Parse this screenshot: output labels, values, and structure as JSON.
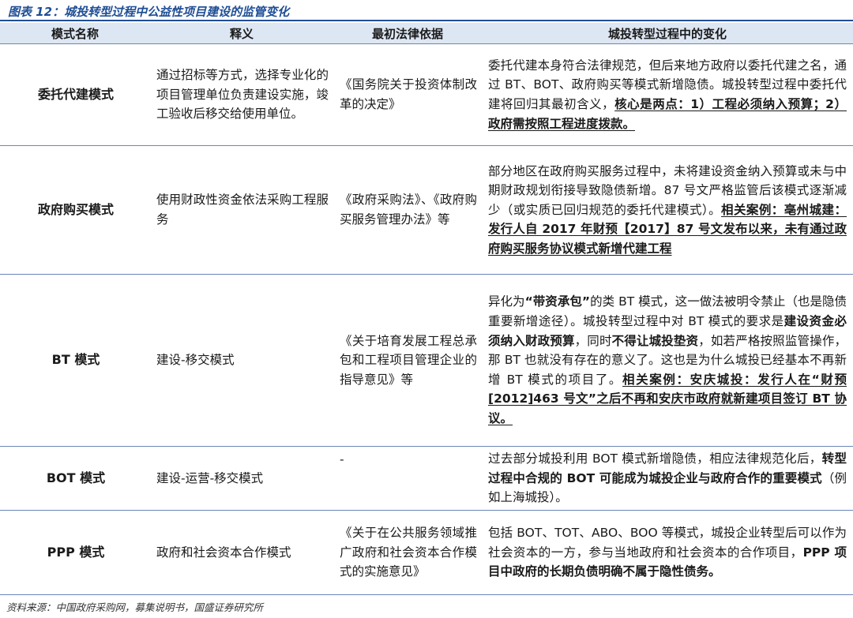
{
  "title": "图表 12：城投转型过程中公益性项目建设的监管变化",
  "headers": [
    "模式名称",
    "释义",
    "最初法律依据",
    "城投转型过程中的变化"
  ],
  "rows": [
    {
      "name": "委托代建模式",
      "desc": "通过招标等方式，选择专业化的项目管理单位负责建设实施，竣工验收后移交给使用单位。",
      "law": "《国务院关于投资体制改革的决定》",
      "change": [
        {
          "t": "委托代建本身符合法律规范，但后来地方政府以委托代建之名，通过 BT、BOT、政府购买等模式新增隐债。城投转型过程中委托代建将回归其最初含义，",
          "s": ""
        },
        {
          "t": "核心是两点：1）工程必须纳入预算；2）政府需按照工程进度拨款。",
          "s": "bu"
        }
      ]
    },
    {
      "name": "政府购买模式",
      "desc": "使用财政性资金依法采购工程服务",
      "law": "《政府采购法》、《政府购买服务管理办法》等",
      "change": [
        {
          "t": "部分地区在政府购买服务过程中，未将建设资金纳入预算或未与中期财政规划衔接导致隐债新增。87 号文严格监管后该模式逐渐减少（或实质已回归规范的委托代建模式）。",
          "s": ""
        },
        {
          "t": "相关案例：亳州城建：发行人自 2017 年财预【2017】87 号文发布以来，未有通过政府购买服务协议模式新增代建工程",
          "s": "bu"
        }
      ]
    },
    {
      "name": "BT 模式",
      "desc": "建设-移交模式",
      "law": "《关于培育发展工程总承包和工程项目管理企业的指导意见》等",
      "change": [
        {
          "t": "异化为",
          "s": ""
        },
        {
          "t": "“带资承包”",
          "s": "b"
        },
        {
          "t": "的类 BT 模式，这一做法被明令禁止（也是隐债重要新增途径）。城投转型过程中对 BT 模式的要求是",
          "s": ""
        },
        {
          "t": "建设资金必须纳入财政预算",
          "s": "b"
        },
        {
          "t": "，同时",
          "s": ""
        },
        {
          "t": "不得让城投垫资",
          "s": "b"
        },
        {
          "t": "，如若严格按照监管操作，那 BT 也就没有存在的意义了。这也是为什么城投已经基本不再新增 BT 模式的项目了。",
          "s": ""
        },
        {
          "t": "相关案例：安庆城投：发行人在“财预[2012]463 号文”之后不再和安庆市政府就新建项目签订 BT 协议。",
          "s": "bu"
        }
      ]
    },
    {
      "name": "BOT 模式",
      "desc": "建设-运营-移交模式",
      "law": "-",
      "change": [
        {
          "t": "过去部分城投利用 BOT 模式新增隐债，相应法律规范化后，",
          "s": ""
        },
        {
          "t": "转型过程中合规的 BOT 可能成为城投企业与政府合作的重要模式",
          "s": "b"
        },
        {
          "t": "（例如上海城投）。",
          "s": ""
        }
      ]
    },
    {
      "name": "PPP 模式",
      "desc": "政府和社会资本合作模式",
      "law": "《关于在公共服务领域推广政府和社会资本合作模式的实施意见》",
      "change": [
        {
          "t": "包括 BOT、TOT、ABO、BOO 等模式，城投企业转型后可以作为社会资本的一方，参与当地政府和社会资本的合作项目，",
          "s": ""
        },
        {
          "t": "PPP 项目中政府的长期负债明确不属于隐性债务。",
          "s": "b"
        }
      ]
    }
  ],
  "source": "资料来源：中国政府采购网，募集说明书，国盛证券研究所"
}
